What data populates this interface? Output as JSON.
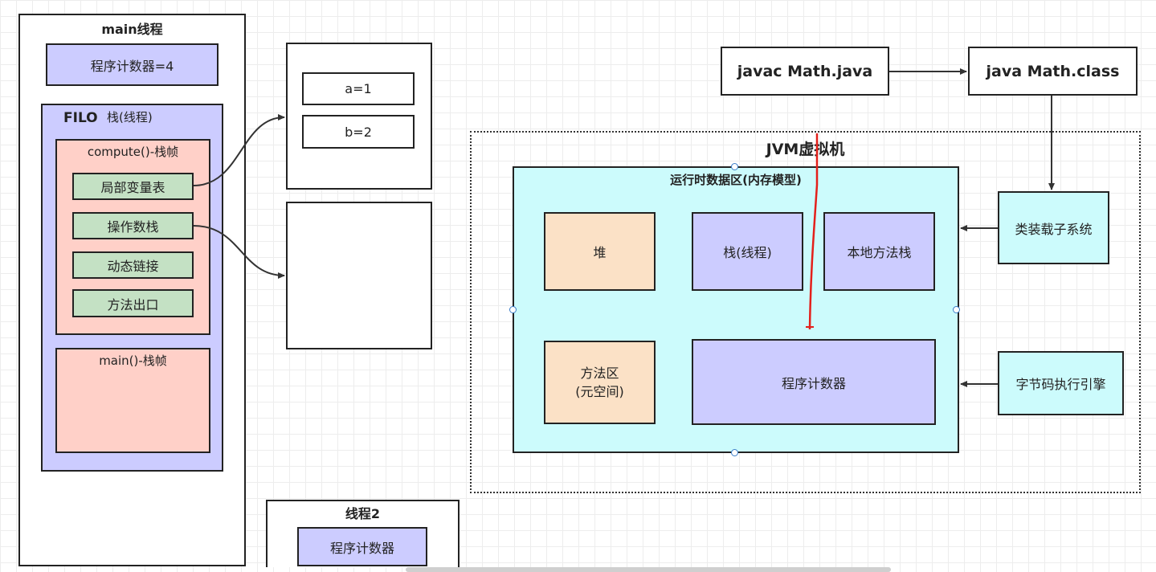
{
  "main_thread": {
    "title": "main线程",
    "pc": "程序计数器=4",
    "stack": {
      "label_filo": "FILO",
      "label_stack": "栈(线程)",
      "compute_frame": {
        "title": "compute()-栈帧",
        "items": [
          "局部变量表",
          "操作数栈",
          "动态链接",
          "方法出口"
        ]
      },
      "main_frame": {
        "title": "main()-栈帧"
      }
    }
  },
  "local_vars": {
    "a": "a=1",
    "b": "b=2"
  },
  "thread2": {
    "title": "线程2",
    "pc": "程序计数器"
  },
  "compile": {
    "javac": "javac Math.java",
    "java": "java Math.class"
  },
  "jvm": {
    "title": "JVM虚拟机",
    "runtime_area": {
      "title": "运行时数据区(内存模型)",
      "heap": "堆",
      "stack": "栈(线程)",
      "native_stack": "本地方法栈",
      "method_area_line1": "方法区",
      "method_area_line2": "(元空间)",
      "pc": "程序计数器"
    },
    "classloader": "类装载子系统",
    "engine": "字节码执行引擎"
  },
  "colors": {
    "purple": "#ccccff",
    "green": "#c4e1c4",
    "pink": "#ffd0c8",
    "peach": "#fbe1c6",
    "cyan": "#ccfbfc",
    "red_annotation": "#e3201b"
  }
}
